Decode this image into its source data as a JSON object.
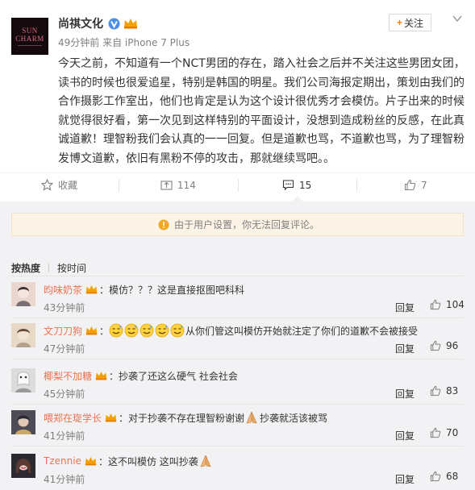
{
  "post": {
    "logo_lines": [
      "SUN",
      "CHARM"
    ],
    "author": "尚祺文化",
    "meta": "49分钟前 来自 iPhone 7 Plus",
    "follow_label": "关注",
    "follow_plus": "+",
    "text": "今天之前，不知道有一个NCT男团的存在，踏入社会之后并不关注这些男团女团，读书的时候也很爱追星，特别是韩国的明星。我们公司海报定期出，策划由我们的合作摄影工作室出，他们也肯定是认为这个设计很优秀才会模仿。片子出来的时候就觉得很好看，第一次见到这样特别的平面设计，没想到造成粉丝的反感，在此真诚道歉！理智粉我们会认真的一一回复。但是道歉也骂，不道歉也骂，为了理智粉发博文道歉，依旧有黑粉不停的攻击，那就继续骂吧。。"
  },
  "actions": {
    "collect": "收藏",
    "repost": "114",
    "comment": "15",
    "like": "7"
  },
  "notice": "由于用户设置，你无法回复评论。",
  "tabs": {
    "hot": "按热度",
    "time": "按时间"
  },
  "comments": [
    {
      "name": "昀味奶茶",
      "text": "：模仿？？？这是直接抠图吧科科",
      "time": "43分钟前",
      "reply": "回复",
      "likes": "104",
      "avatar_color": "#e9d6cf"
    },
    {
      "name": "文刀刀狗",
      "text_prefix": "：",
      "text": "从你们管这叫模仿开始就注定了你们的道歉不会被接受",
      "time": "47分钟前",
      "reply": "回复",
      "likes": "96",
      "avatar_color": "#e8d9c6"
    },
    {
      "name": "椰梨不加糖",
      "text": "：抄袭了还这么硬气 社会社会",
      "time": "45分钟前",
      "reply": "回复",
      "likes": "83",
      "avatar_color": "#c9c9c9"
    },
    {
      "name": "喂郑在琁学长",
      "text": "：对于抄袭不存在理智粉谢谢",
      "text2": "抄袭就活该被骂",
      "time": "41分钟前",
      "reply": "回复",
      "likes": "70",
      "avatar_color": "#6d6a74"
    },
    {
      "name": "Tzennie",
      "text": "：这不叫模仿 这叫抄袭",
      "time": "41分钟前",
      "reply": "回复",
      "likes": "68",
      "avatar_color": "#2c2a30"
    }
  ],
  "colors": {
    "name": "#eb7350",
    "notice_bg": "#fbf4e6",
    "panel_bg": "#f2f2f5",
    "accent": "#ff8200"
  }
}
